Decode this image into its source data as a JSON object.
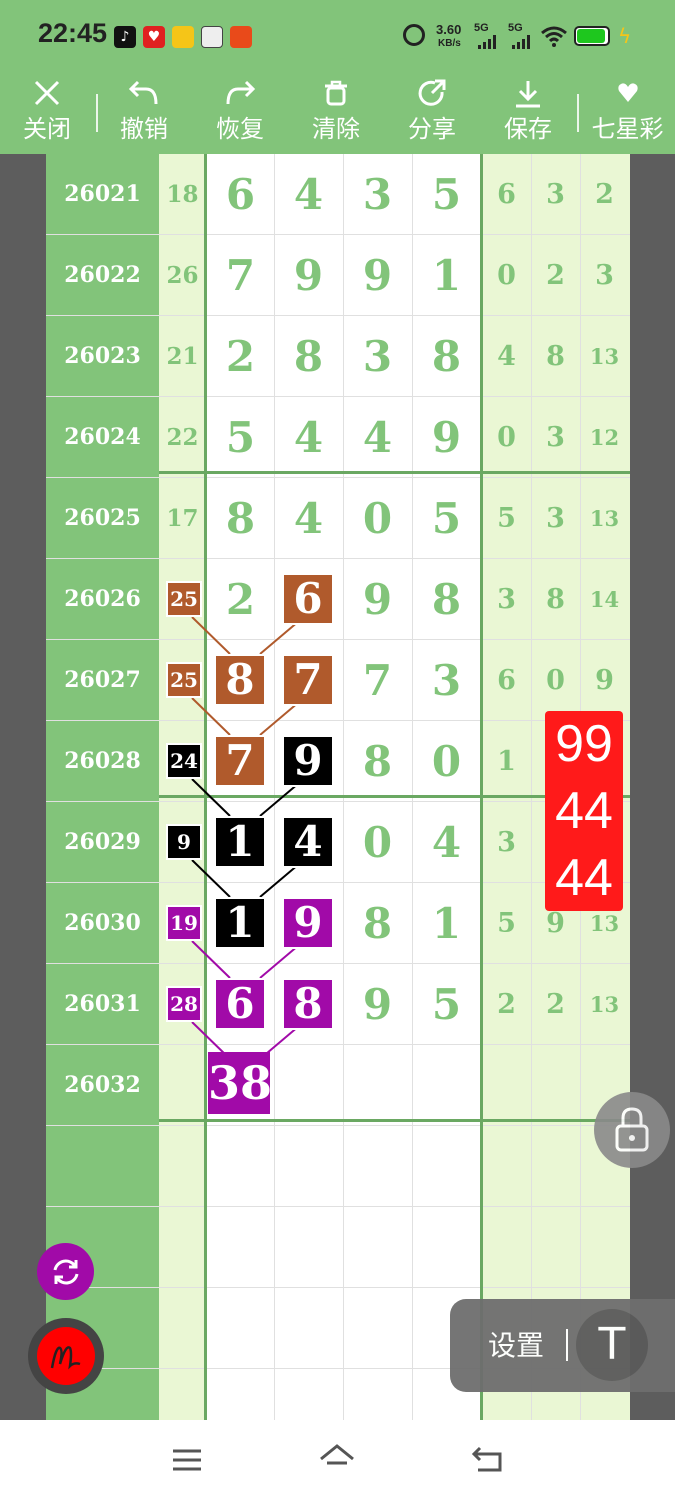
{
  "status_bar": {
    "time": "22:45",
    "net_speed_value": "3.60",
    "net_speed_unit": "KB/s",
    "sim1": "5G",
    "sim2": "5G",
    "app_icons": [
      "tiktok-icon",
      "heart-app-icon",
      "coin-app-icon",
      "avatar-app-icon",
      "red-app-icon"
    ],
    "system_icons": [
      "alarm-icon",
      "signal-icon",
      "signal-icon",
      "wifi-icon",
      "battery-icon",
      "charging-icon"
    ]
  },
  "toolbar": {
    "buttons": [
      {
        "label": "关闭",
        "icon": "close-icon"
      },
      {
        "label": "撤销",
        "icon": "undo-icon"
      },
      {
        "label": "恢复",
        "icon": "redo-icon"
      },
      {
        "label": "清除",
        "icon": "trash-icon"
      },
      {
        "label": "分享",
        "icon": "share-icon"
      },
      {
        "label": "保存",
        "icon": "download-icon"
      },
      {
        "label": "七星彩",
        "icon": "heart-icon"
      }
    ]
  },
  "table": {
    "rows": [
      {
        "issue": "26021",
        "sum": "18",
        "digits": [
          "6",
          "4",
          "3",
          "5"
        ],
        "right": [
          "6",
          "3",
          "2"
        ]
      },
      {
        "issue": "26022",
        "sum": "26",
        "digits": [
          "7",
          "9",
          "9",
          "1"
        ],
        "right": [
          "0",
          "2",
          "3"
        ]
      },
      {
        "issue": "26023",
        "sum": "21",
        "digits": [
          "2",
          "8",
          "3",
          "8"
        ],
        "right": [
          "4",
          "8",
          "13"
        ]
      },
      {
        "issue": "26024",
        "sum": "22",
        "digits": [
          "5",
          "4",
          "4",
          "9"
        ],
        "right": [
          "0",
          "3",
          "12"
        ]
      },
      {
        "issue": "26025",
        "sum": "17",
        "digits": [
          "8",
          "4",
          "0",
          "5"
        ],
        "right": [
          "5",
          "3",
          "13"
        ]
      },
      {
        "issue": "26026",
        "sum": "25",
        "digits": [
          "2",
          "6",
          "9",
          "8"
        ],
        "right": [
          "3",
          "8",
          "14"
        ]
      },
      {
        "issue": "26027",
        "sum": "25",
        "digits": [
          "8",
          "7",
          "7",
          "3"
        ],
        "right": [
          "6",
          "0",
          "9"
        ]
      },
      {
        "issue": "26028",
        "sum": "24",
        "digits": [
          "7",
          "9",
          "8",
          "0"
        ],
        "right": [
          "1",
          "",
          ""
        ]
      },
      {
        "issue": "26029",
        "sum": "9",
        "digits": [
          "1",
          "4",
          "0",
          "4"
        ],
        "right": [
          "3",
          "",
          ""
        ]
      },
      {
        "issue": "26030",
        "sum": "19",
        "digits": [
          "1",
          "9",
          "8",
          "1"
        ],
        "right": [
          "5",
          "9",
          "13"
        ]
      },
      {
        "issue": "26031",
        "sum": "28",
        "digits": [
          "6",
          "8",
          "9",
          "5"
        ],
        "right": [
          "2",
          "2",
          "13"
        ]
      },
      {
        "issue": "26032",
        "sum": "",
        "digits": [
          "",
          "",
          "",
          ""
        ],
        "right": [
          "",
          "",
          ""
        ]
      }
    ],
    "marked_final": "38"
  },
  "overlay_red": [
    "99",
    "44",
    "44"
  ],
  "settings_label": "设置",
  "t_button": "T",
  "colors": {
    "green": "#82c47a",
    "light_green": "#eaf7d4",
    "brown": "#b05a2c",
    "black": "#000000",
    "purple": "#a10aa8",
    "red": "#ff1a1a"
  }
}
